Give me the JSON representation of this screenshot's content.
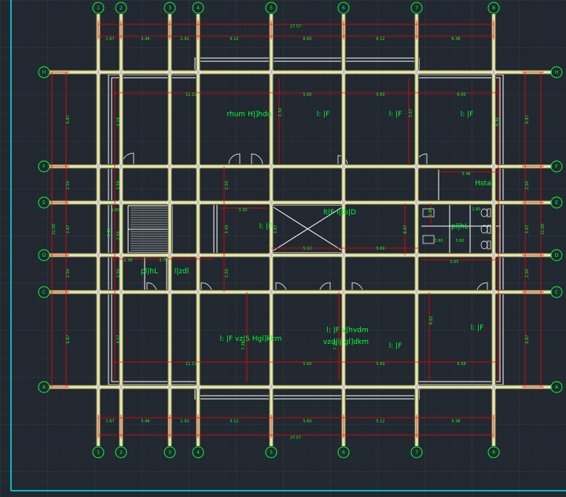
{
  "colors": {
    "background": "#212830",
    "grid": "#2d3742",
    "wall": "#ffffff",
    "beam": "#e8e8a8",
    "dimension": "#ff0000",
    "text": "#00ff33",
    "frame": "#00e5ee"
  },
  "grid_numbers": [
    "1",
    "2",
    "3",
    "4",
    "5",
    "6",
    "7",
    "8"
  ],
  "grid_letters": [
    "H",
    "F",
    "E",
    "D",
    "C",
    "B",
    "A"
  ],
  "dims_top": {
    "total": "27.57",
    "spans": [
      "1.67",
      "3.46",
      "1.92",
      "6.12",
      "6.60",
      "6.12",
      "6.38"
    ]
  },
  "dims_bottom": {
    "total": "27.57",
    "spans": [
      "1.67",
      "3.46",
      "1.92",
      "5.12",
      "5.60",
      "5.12",
      "5.38"
    ]
  },
  "dims_left": {
    "total": "22.00",
    "spans": [
      "6.87",
      "2.50",
      "3.67",
      "2.50",
      "6.87"
    ],
    "inner": [
      "6.19",
      "3.59",
      "3.43",
      "2.50",
      "4.57"
    ]
  },
  "dims_right": {
    "total": "22.00",
    "spans": [
      "6.87",
      "2.50",
      "3.67",
      "2.50",
      "6.87"
    ],
    "inner": [
      "6.36"
    ]
  },
  "dims_inner": {
    "row1": [
      "11.12",
      "5.60",
      "5.60",
      "6.00"
    ],
    "row2": [
      "11.13",
      "5.60",
      "5.60",
      "6.08"
    ],
    "mid": [
      "3.30",
      "5.12",
      "5.60",
      "5.05",
      "1.60",
      "3.60",
      "3.48",
      "2.36",
      "2.70",
      "1.60",
      "3.60"
    ],
    "vertical": [
      "2.32",
      "2.50",
      "3.43",
      "2.50",
      "7.38",
      "7.38",
      "3.67",
      "8.67",
      "8.62",
      "2.86",
      "3.67",
      "2.50",
      "2.87",
      "8.47",
      "5.47"
    ]
  },
  "rooms": {
    "top_hall": "rhum H|]hdu",
    "top_r1": "l: |F",
    "top_r2": "l: |F",
    "top_r3": "l: |F",
    "wc_top": "Hsta|",
    "stair_void": "lt|F l|]b|D",
    "center_left": "l: |F",
    "stair_label": "pl|hL",
    "stair_label2": "l|zdl",
    "wc_right": "pl|hL",
    "bottom_hall": "l: |F  vz|S  Hgl]kkm",
    "bottom_r1a": "l: |F  v|hvdm",
    "bottom_r1b": "vzd|ij  gl]dkm",
    "bottom_r2": "l: |F",
    "bottom_r3": "l: |F"
  }
}
